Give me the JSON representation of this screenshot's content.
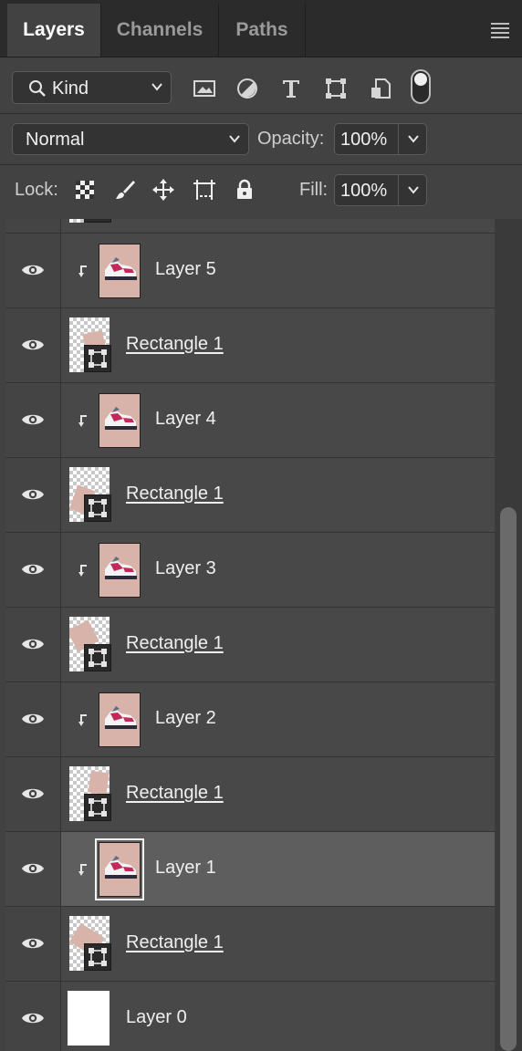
{
  "tabs": [
    {
      "label": "Layers",
      "active": true
    },
    {
      "label": "Channels",
      "active": false
    },
    {
      "label": "Paths",
      "active": false
    }
  ],
  "filter": {
    "kind_label": "Kind",
    "icons": [
      "pixel-layer-filter-icon",
      "adjustment-layer-filter-icon",
      "type-layer-filter-icon",
      "shape-layer-filter-icon",
      "smart-object-filter-icon"
    ]
  },
  "blend": {
    "mode": "Normal",
    "opacity_label": "Opacity:",
    "opacity_value": "100%"
  },
  "lock": {
    "label": "Lock:",
    "fill_label": "Fill:",
    "fill_value": "100%"
  },
  "layers": [
    {
      "name": "Layer 5",
      "type": "image",
      "clipped": true,
      "selected": false
    },
    {
      "name": "Rectangle 1",
      "type": "shape",
      "clipped": false,
      "selected": false
    },
    {
      "name": "Layer 4",
      "type": "image",
      "clipped": true,
      "selected": false
    },
    {
      "name": "Rectangle 1",
      "type": "shape",
      "clipped": false,
      "selected": false
    },
    {
      "name": "Layer 3",
      "type": "image",
      "clipped": true,
      "selected": false
    },
    {
      "name": "Rectangle 1",
      "type": "shape",
      "clipped": false,
      "selected": false
    },
    {
      "name": "Layer 2",
      "type": "image",
      "clipped": true,
      "selected": false
    },
    {
      "name": "Rectangle 1",
      "type": "shape",
      "clipped": false,
      "selected": false
    },
    {
      "name": "Layer 1",
      "type": "image",
      "clipped": true,
      "selected": true
    },
    {
      "name": "Rectangle 1",
      "type": "shape",
      "clipped": false,
      "selected": false
    },
    {
      "name": "Layer 0",
      "type": "background",
      "clipped": false,
      "selected": false
    }
  ],
  "colors": {
    "panel": "#424242",
    "selected_row": "#5e5e5e",
    "swatch": "#d8b3aa",
    "shoe_accent": "#c22a5a"
  }
}
